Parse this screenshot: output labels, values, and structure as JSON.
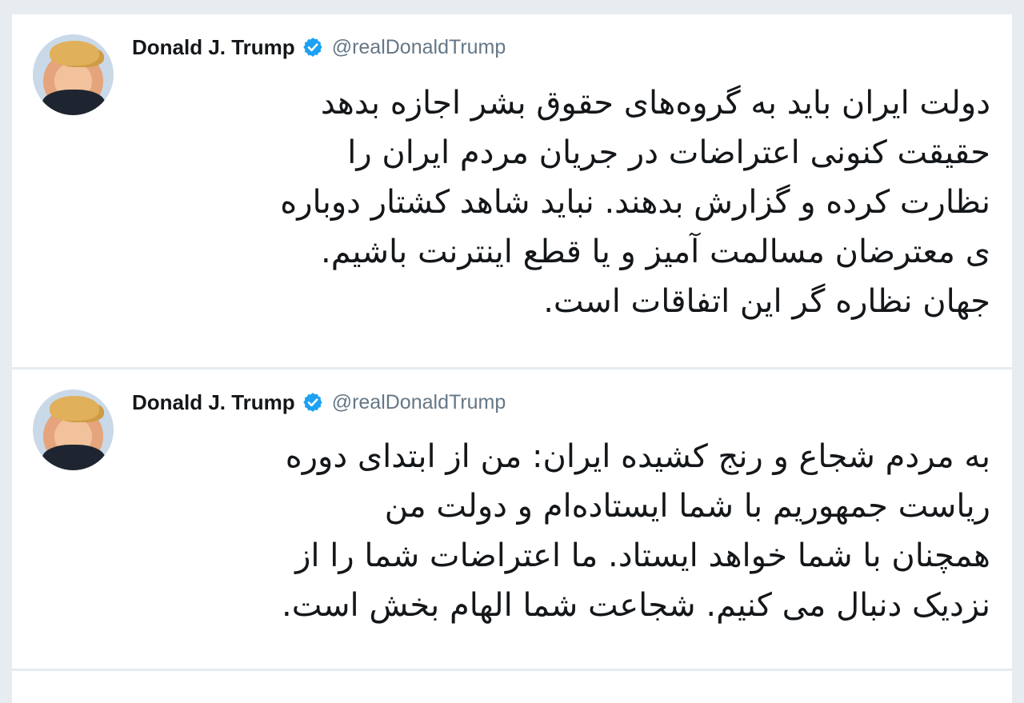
{
  "tweets": [
    {
      "author_name": "Donald J. Trump",
      "author_handle": "@realDonaldTrump",
      "verified": true,
      "text": "دولت ایران باید به گروه‌های حقوق بشر اجازه بدهد\nحقیقت کنونی اعتراضات در جریان مردم ایران را\nنظارت کرده و گزارش بدهند. نباید شاهد کشتار دوباره\nی معترضان مسالمت آمیز و یا قطع اینترنت باشیم.\nجهان نظاره گر این اتفاقات است."
    },
    {
      "author_name": "Donald J. Trump",
      "author_handle": "@realDonaldTrump",
      "verified": true,
      "text": "به مردم شجاع و رنج کشیده ایران: من از ابتدای دوره\nریاست جمهوریم با شما ایستاده‌ام و دولت من\nهمچنان با شما خواهد ایستاد. ما اعتراضات شما را از\nنزدیک دنبال می کنیم. شجاعت شما الهام بخش است."
    }
  ],
  "colors": {
    "background": "#e6ecf0",
    "card": "#ffffff",
    "verified_badge": "#1da1f2",
    "handle_text": "#657786",
    "body_text": "#14171a"
  },
  "icons": {
    "verified": "verified-badge-icon",
    "avatar": "profile-avatar"
  }
}
